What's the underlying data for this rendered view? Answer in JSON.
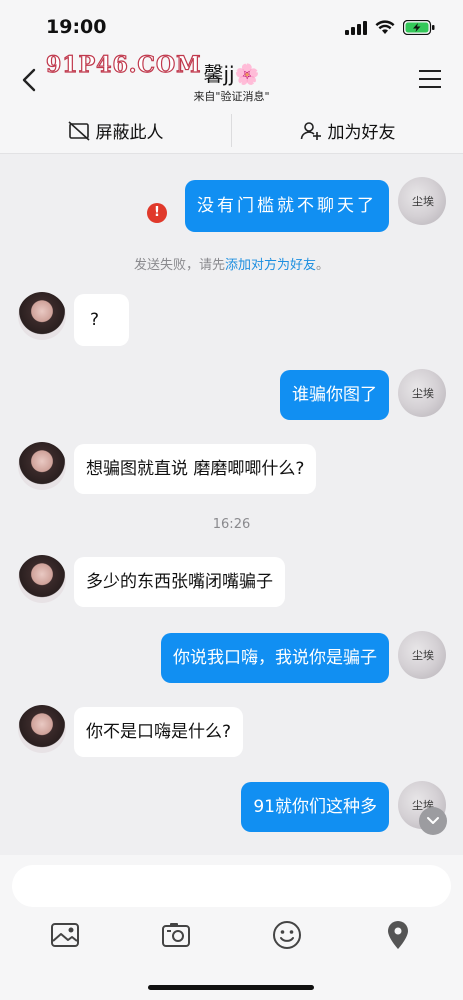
{
  "status_bar": {
    "time": "19:00",
    "icons": [
      "signal-icon",
      "wifi-icon",
      "battery-charging-icon"
    ]
  },
  "header": {
    "watermark": "91P46.COM",
    "title": "馨jj🌸",
    "subtitle": "来自\"验证消息\"",
    "back_icon": "chevron-left-icon",
    "menu_icon": "hamburger-menu-icon"
  },
  "actions": {
    "block_label": "屏蔽此人",
    "add_friend_label": "加为好友"
  },
  "messages": [
    {
      "side": "out",
      "text": "没有门槛就不聊天了",
      "failed": true
    },
    {
      "type": "notice",
      "text": "发送失败，请先",
      "link": "添加对方为好友",
      "suffix": "。"
    },
    {
      "side": "in",
      "text": "?"
    },
    {
      "side": "out",
      "text": "谁骗你图了"
    },
    {
      "side": "in",
      "text": "想骗图就直说 磨磨唧唧什么?"
    },
    {
      "type": "time",
      "text": "16:26"
    },
    {
      "side": "in",
      "text": "多少的东西张嘴闭嘴骗子"
    },
    {
      "side": "out",
      "text": "你说我口嗨，我说你是骗子"
    },
    {
      "side": "in",
      "text": "你不是口嗨是什么?"
    },
    {
      "side": "out",
      "text": "91就你们这种多"
    }
  ],
  "self_avatar_text": "尘埃",
  "error_mark": "!",
  "input": {
    "placeholder": ""
  },
  "toolbar_icons": [
    "image-icon",
    "camera-icon",
    "emoji-icon",
    "location-pin-icon"
  ],
  "colors": {
    "outgoing_bubble": "#118ff2",
    "incoming_bubble": "#ffffff",
    "background": "#efeff1",
    "error": "#e0392b",
    "link": "#1d8fe0"
  }
}
